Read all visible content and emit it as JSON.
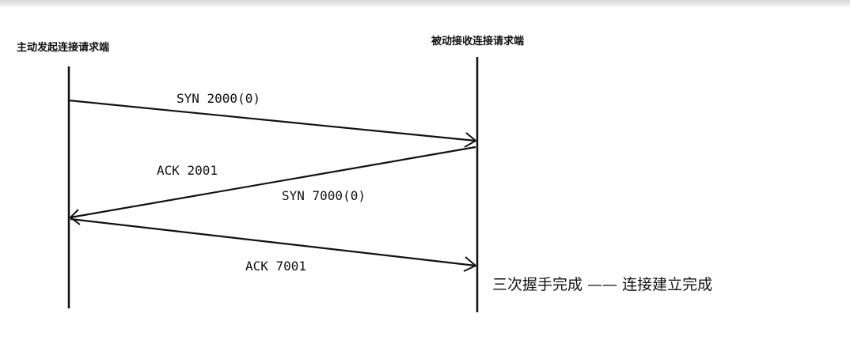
{
  "hosts": {
    "left_label": "主动发起连接请求端",
    "right_label": "被动接收连接请求端"
  },
  "messages": [
    {
      "text": "SYN  2000(0)",
      "from": "left",
      "to": "right"
    },
    {
      "text": "ACK  2001",
      "from": "right",
      "to": "left"
    },
    {
      "text": "SYN  7000(0)",
      "from": "right",
      "to": "left"
    },
    {
      "text": "ACK 7001",
      "from": "left",
      "to": "right"
    }
  ],
  "result_text": "三次握手完成 —— 连接建立完成",
  "colors": {
    "line": "#111111",
    "text": "#111111",
    "background": "#ffffff"
  }
}
